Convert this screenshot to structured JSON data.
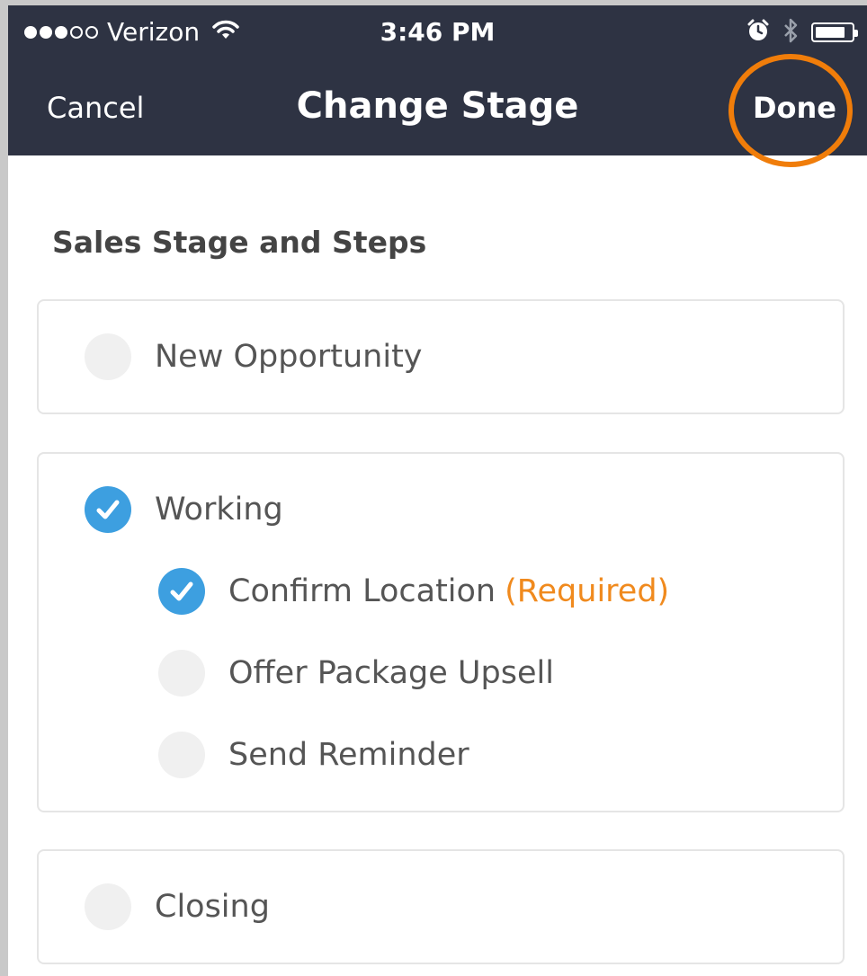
{
  "status_bar": {
    "carrier": "Verizon",
    "time": "3:46 PM",
    "signal_bars_filled": 3,
    "signal_bars_total": 5,
    "battery_level": 0.85,
    "icons": [
      "wifi-icon",
      "alarm-icon",
      "bluetooth-icon",
      "battery-icon"
    ]
  },
  "nav": {
    "cancel_label": "Cancel",
    "title": "Change Stage",
    "done_label": "Done"
  },
  "section_title": "Sales Stage and Steps",
  "stages": [
    {
      "label": "New Opportunity",
      "checked": false
    },
    {
      "label": "Working",
      "checked": true,
      "steps": [
        {
          "label": "Confirm Location",
          "required_label": "(Required)",
          "checked": true
        },
        {
          "label": "Offer Package Upsell",
          "checked": false
        },
        {
          "label": "Send Reminder",
          "checked": false
        }
      ]
    },
    {
      "label": "Closing",
      "checked": false
    }
  ],
  "colors": {
    "header_bg": "#2e3343",
    "check_blue": "#3d9fe0",
    "required_orange": "#f08a1e",
    "highlight_ring": "#f07d0a"
  }
}
